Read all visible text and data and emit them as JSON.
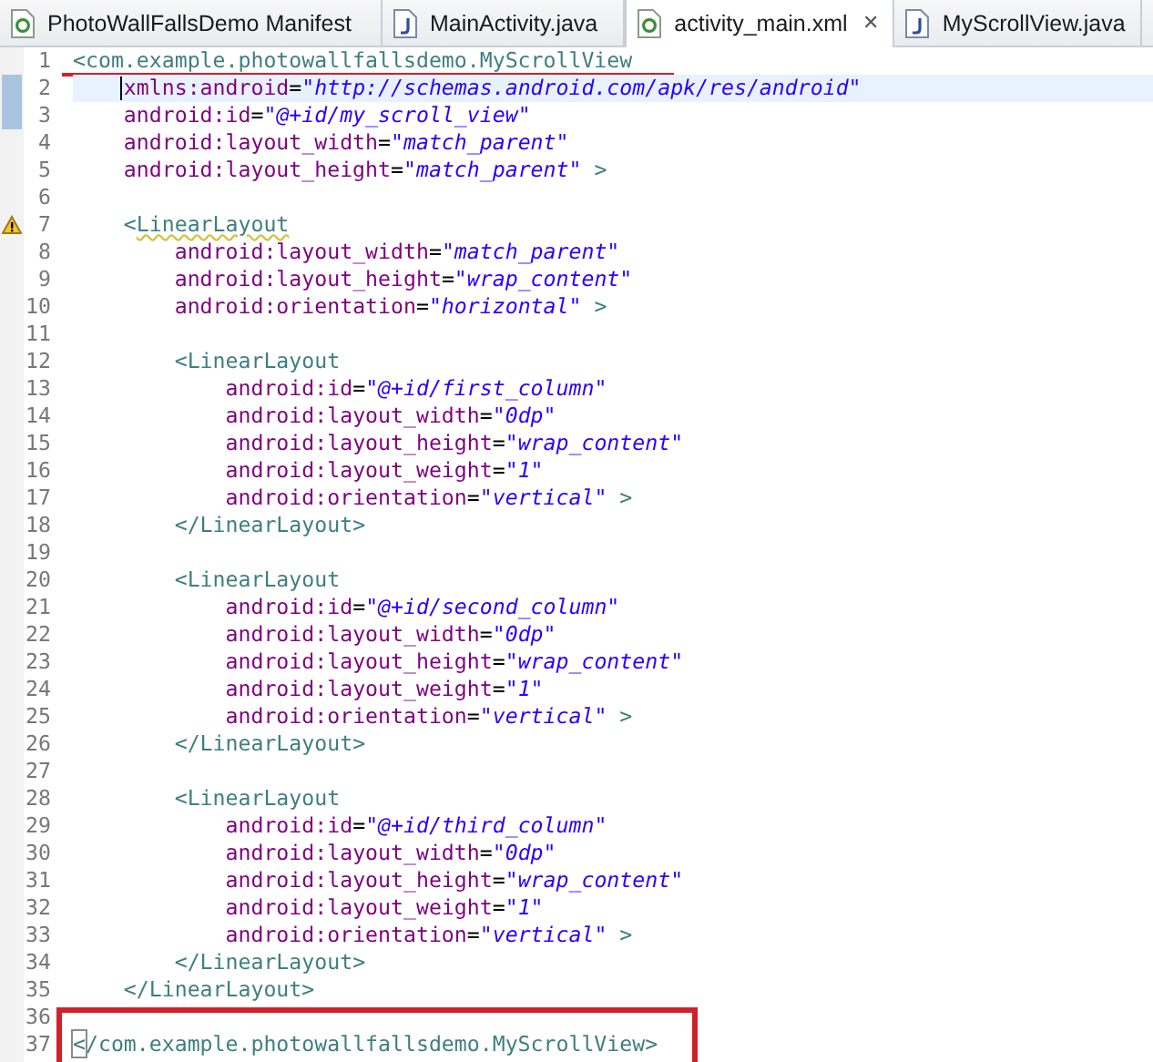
{
  "tabs": [
    {
      "label": "PhotoWallFallsDemo Manifest",
      "kind": "xml",
      "selected": false
    },
    {
      "label": "MainActivity.java",
      "kind": "java",
      "selected": false
    },
    {
      "label": "activity_main.xml",
      "kind": "xml",
      "selected": true,
      "close": "✕"
    },
    {
      "label": "MyScrollView.java",
      "kind": "java",
      "selected": false
    }
  ],
  "editor": {
    "lines": [
      {
        "number": "1",
        "underlined": true,
        "segments": [
          {
            "kind": "tag",
            "text": "<com.example.photowallfallsdemo.MyScrollView"
          }
        ]
      },
      {
        "number": "2",
        "current": true,
        "cursor": true,
        "occurrence": true,
        "segments": [
          {
            "kind": "attr",
            "text": "    xmlns:android"
          },
          {
            "kind": "op",
            "text": "="
          },
          {
            "kind": "value",
            "text": "\"http://schemas.android.com/apk/res/android\""
          }
        ]
      },
      {
        "number": "3",
        "occurrence": true,
        "segments": [
          {
            "kind": "attr",
            "text": "    android:id"
          },
          {
            "kind": "op",
            "text": "="
          },
          {
            "kind": "value",
            "text": "\"@+id/my_scroll_view\""
          }
        ]
      },
      {
        "number": "4",
        "segments": [
          {
            "kind": "attr",
            "text": "    android:layout_width"
          },
          {
            "kind": "op",
            "text": "="
          },
          {
            "kind": "value",
            "text": "\"match_parent\""
          }
        ]
      },
      {
        "number": "5",
        "segments": [
          {
            "kind": "attr",
            "text": "    android:layout_height"
          },
          {
            "kind": "op",
            "text": "="
          },
          {
            "kind": "value",
            "text": "\"match_parent\""
          },
          {
            "kind": "tag",
            "text": " >"
          }
        ]
      },
      {
        "number": "6"
      },
      {
        "number": "7",
        "warning": true,
        "segments": [
          {
            "kind": "tag",
            "text": "    <"
          },
          {
            "kind": "warn",
            "text": "LinearLayout"
          }
        ]
      },
      {
        "number": "8",
        "segments": [
          {
            "kind": "attr",
            "text": "        android:layout_width"
          },
          {
            "kind": "op",
            "text": "="
          },
          {
            "kind": "value",
            "text": "\"match_parent\""
          }
        ]
      },
      {
        "number": "9",
        "segments": [
          {
            "kind": "attr",
            "text": "        android:layout_height"
          },
          {
            "kind": "op",
            "text": "="
          },
          {
            "kind": "value",
            "text": "\"wrap_content\""
          }
        ]
      },
      {
        "number": "10",
        "segments": [
          {
            "kind": "attr",
            "text": "        android:orientation"
          },
          {
            "kind": "op",
            "text": "="
          },
          {
            "kind": "value",
            "text": "\"horizontal\""
          },
          {
            "kind": "tag",
            "text": " >"
          }
        ]
      },
      {
        "number": "11"
      },
      {
        "number": "12",
        "segments": [
          {
            "kind": "tag",
            "text": "        <LinearLayout"
          }
        ]
      },
      {
        "number": "13",
        "segments": [
          {
            "kind": "attr",
            "text": "            android:id"
          },
          {
            "kind": "op",
            "text": "="
          },
          {
            "kind": "value",
            "text": "\"@+id/first_column\""
          }
        ]
      },
      {
        "number": "14",
        "segments": [
          {
            "kind": "attr",
            "text": "            android:layout_width"
          },
          {
            "kind": "op",
            "text": "="
          },
          {
            "kind": "value",
            "text": "\"0dp\""
          }
        ]
      },
      {
        "number": "15",
        "segments": [
          {
            "kind": "attr",
            "text": "            android:layout_height"
          },
          {
            "kind": "op",
            "text": "="
          },
          {
            "kind": "value",
            "text": "\"wrap_content\""
          }
        ]
      },
      {
        "number": "16",
        "segments": [
          {
            "kind": "attr",
            "text": "            android:layout_weight"
          },
          {
            "kind": "op",
            "text": "="
          },
          {
            "kind": "value",
            "text": "\"1\""
          }
        ]
      },
      {
        "number": "17",
        "segments": [
          {
            "kind": "attr",
            "text": "            android:orientation"
          },
          {
            "kind": "op",
            "text": "="
          },
          {
            "kind": "value",
            "text": "\"vertical\""
          },
          {
            "kind": "tag",
            "text": " >"
          }
        ]
      },
      {
        "number": "18",
        "segments": [
          {
            "kind": "tag",
            "text": "        </LinearLayout>"
          }
        ]
      },
      {
        "number": "19"
      },
      {
        "number": "20",
        "segments": [
          {
            "kind": "tag",
            "text": "        <LinearLayout"
          }
        ]
      },
      {
        "number": "21",
        "segments": [
          {
            "kind": "attr",
            "text": "            android:id"
          },
          {
            "kind": "op",
            "text": "="
          },
          {
            "kind": "value",
            "text": "\"@+id/second_column\""
          }
        ]
      },
      {
        "number": "22",
        "segments": [
          {
            "kind": "attr",
            "text": "            android:layout_width"
          },
          {
            "kind": "op",
            "text": "="
          },
          {
            "kind": "value",
            "text": "\"0dp\""
          }
        ]
      },
      {
        "number": "23",
        "segments": [
          {
            "kind": "attr",
            "text": "            android:layout_height"
          },
          {
            "kind": "op",
            "text": "="
          },
          {
            "kind": "value",
            "text": "\"wrap_content\""
          }
        ]
      },
      {
        "number": "24",
        "segments": [
          {
            "kind": "attr",
            "text": "            android:layout_weight"
          },
          {
            "kind": "op",
            "text": "="
          },
          {
            "kind": "value",
            "text": "\"1\""
          }
        ]
      },
      {
        "number": "25",
        "segments": [
          {
            "kind": "attr",
            "text": "            android:orientation"
          },
          {
            "kind": "op",
            "text": "="
          },
          {
            "kind": "value",
            "text": "\"vertical\""
          },
          {
            "kind": "tag",
            "text": " >"
          }
        ]
      },
      {
        "number": "26",
        "segments": [
          {
            "kind": "tag",
            "text": "        </LinearLayout>"
          }
        ]
      },
      {
        "number": "27"
      },
      {
        "number": "28",
        "segments": [
          {
            "kind": "tag",
            "text": "        <LinearLayout"
          }
        ]
      },
      {
        "number": "29",
        "segments": [
          {
            "kind": "attr",
            "text": "            android:id"
          },
          {
            "kind": "op",
            "text": "="
          },
          {
            "kind": "value",
            "text": "\"@+id/third_column\""
          }
        ]
      },
      {
        "number": "30",
        "segments": [
          {
            "kind": "attr",
            "text": "            android:layout_width"
          },
          {
            "kind": "op",
            "text": "="
          },
          {
            "kind": "value",
            "text": "\"0dp\""
          }
        ]
      },
      {
        "number": "31",
        "segments": [
          {
            "kind": "attr",
            "text": "            android:layout_height"
          },
          {
            "kind": "op",
            "text": "="
          },
          {
            "kind": "value",
            "text": "\"wrap_content\""
          }
        ]
      },
      {
        "number": "32",
        "segments": [
          {
            "kind": "attr",
            "text": "            android:layout_weight"
          },
          {
            "kind": "op",
            "text": "="
          },
          {
            "kind": "value",
            "text": "\"1\""
          }
        ]
      },
      {
        "number": "33",
        "segments": [
          {
            "kind": "attr",
            "text": "            android:orientation"
          },
          {
            "kind": "op",
            "text": "="
          },
          {
            "kind": "value",
            "text": "\"vertical\""
          },
          {
            "kind": "tag",
            "text": " >"
          }
        ]
      },
      {
        "number": "34",
        "segments": [
          {
            "kind": "tag",
            "text": "        </LinearLayout>"
          }
        ]
      },
      {
        "number": "35",
        "segments": [
          {
            "kind": "tag",
            "text": "    </LinearLayout>"
          }
        ]
      },
      {
        "number": "36",
        "boxed": true
      },
      {
        "number": "37",
        "boxed": true,
        "bracket_match": true,
        "segments": [
          {
            "kind": "tag",
            "text": "</com.example.photowallfallsdemo.MyScrollView>"
          }
        ]
      }
    ]
  }
}
